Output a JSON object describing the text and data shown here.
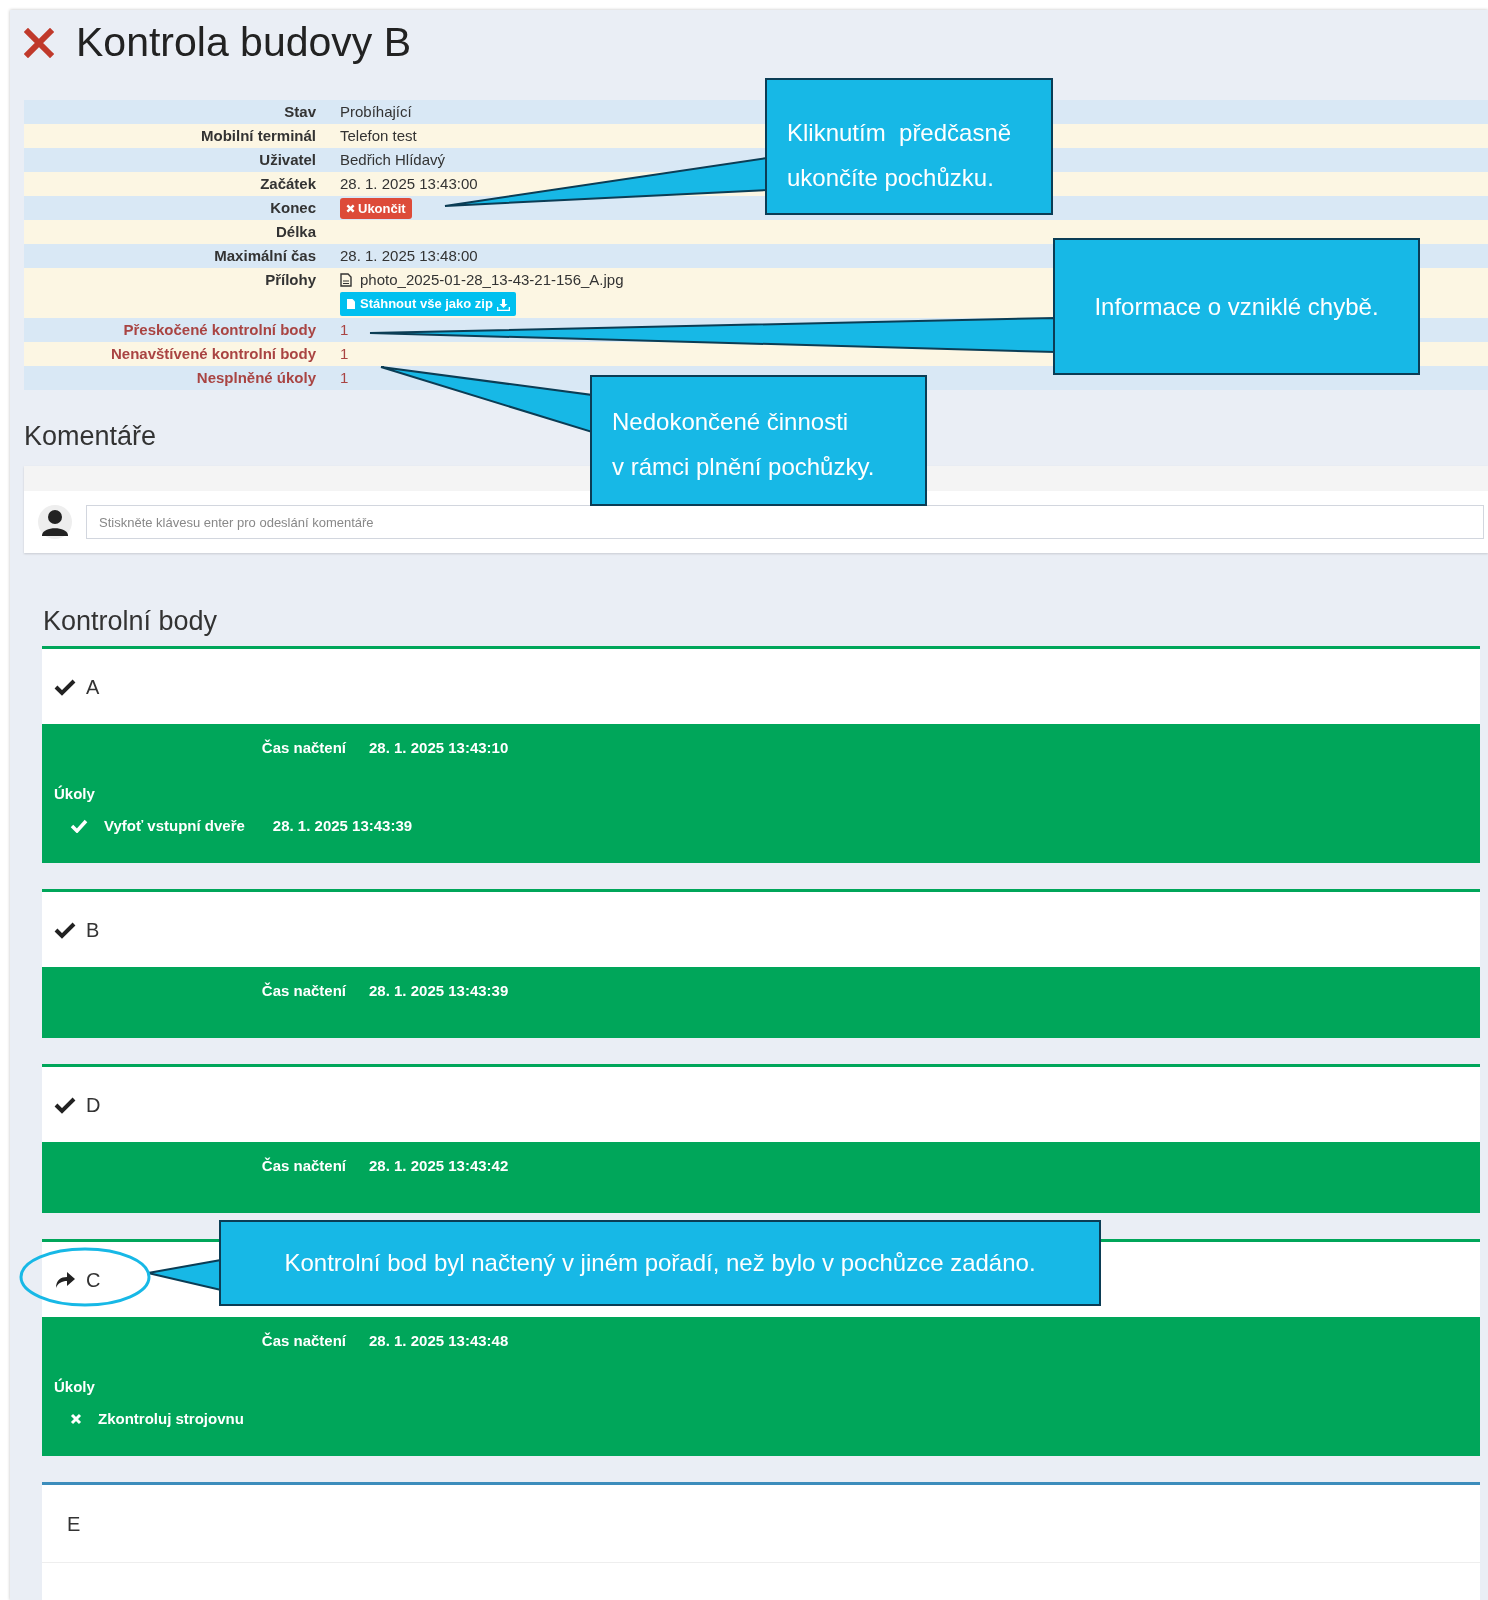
{
  "title": "Kontrola budovy B",
  "info": [
    {
      "label": "Stav",
      "kind": "text",
      "value": "Probíhající",
      "alert": false
    },
    {
      "label": "Mobilní terminál",
      "kind": "text",
      "value": "Telefon test",
      "alert": false
    },
    {
      "label": "Uživatel",
      "kind": "text",
      "value": "Bedřich Hlídavý",
      "alert": false
    },
    {
      "label": "Začátek",
      "kind": "text",
      "value": "28. 1. 2025 13:43:00",
      "alert": false
    },
    {
      "label": "Konec",
      "kind": "button",
      "value": "Ukončit",
      "alert": false
    },
    {
      "label": "Délka",
      "kind": "text",
      "alert": false
    },
    {
      "label": "Maximální čas",
      "kind": "text",
      "value": "28. 1. 2025 13:48:00",
      "alert": false
    },
    {
      "label": "Přílohy",
      "kind": "files",
      "value": "photo_2025-01-28_13-43-21-156_A.jpg",
      "button": "Stáhnout vše jako zip",
      "alert": false
    },
    {
      "label": "Přeskočené kontrolní body",
      "kind": "text",
      "value": "1",
      "alert": true
    },
    {
      "label": "Nenavštívené kontrolní body",
      "kind": "text",
      "value": "1",
      "alert": true
    },
    {
      "label": "Nesplněné úkoly",
      "kind": "text",
      "value": "1",
      "alert": true
    }
  ],
  "comments": {
    "title": "Komentáře",
    "placeholder": "Stiskněte klávesu enter pro odeslání komentáře"
  },
  "checkpoints_title": "Kontrolní body",
  "checkpoints": [
    {
      "name": "A",
      "kind": "scanned",
      "visited": true,
      "scan_label": "Čas načtení",
      "scan_time": "28. 1. 2025 13:43:10",
      "tasks_label": "Úkoly",
      "tasks": [
        {
          "name": "Vyfoť vstupní dveře",
          "done": true,
          "time": "28. 1. 2025 13:43:39"
        }
      ]
    },
    {
      "name": "B",
      "kind": "scanned",
      "visited": true,
      "scan_label": "Čas načtení",
      "scan_time": "28. 1. 2025 13:43:39"
    },
    {
      "name": "D",
      "kind": "scanned",
      "visited": true,
      "scan_label": "Čas načtení",
      "scan_time": "28. 1. 2025 13:43:42"
    },
    {
      "name": "C",
      "kind": "reordered",
      "visited": true,
      "scan_label": "Čas načtení",
      "scan_time": "28. 1. 2025 13:43:48",
      "tasks_label": "Úkoly",
      "tasks": [
        {
          "name": "Zkontroluj strojovnu",
          "done": false
        }
      ]
    },
    {
      "name": "E",
      "kind": "pending",
      "visited": false
    }
  ],
  "callouts": [
    "Kliknutím  předčasně\nukončíte pochůzku.",
    "Informace o vzniklé chybě.",
    "Nedokončené činnosti\nv rámci plnění pochůzky.",
    "Kontrolní bod byl načtený v jiném pořadí, než bylo v pochůzce zadáno."
  ]
}
